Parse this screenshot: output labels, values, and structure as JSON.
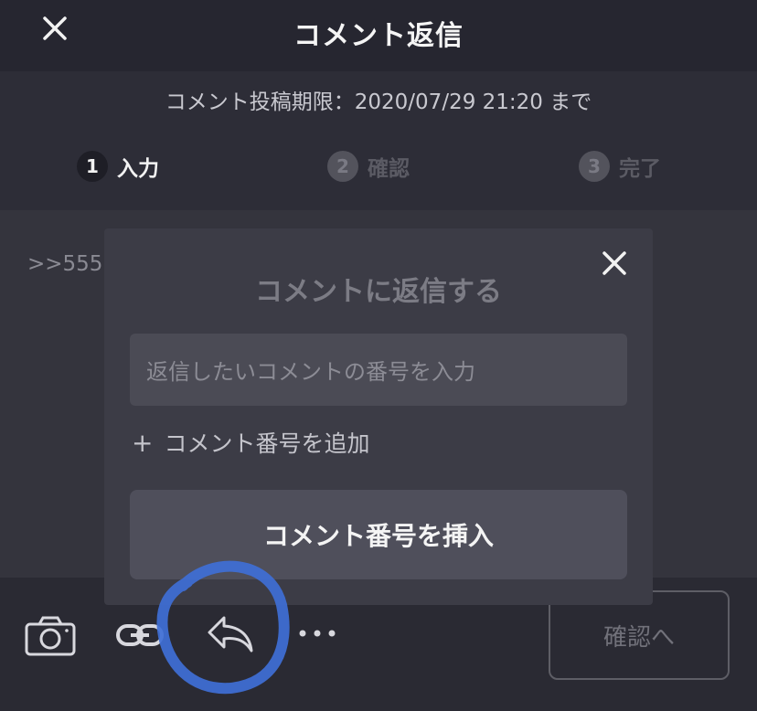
{
  "header": {
    "title": "コメント返信",
    "close_icon": "close-icon"
  },
  "deadline": "コメント投稿期限：2020/07/29 21:20 まで",
  "steps": [
    {
      "num": "1",
      "label": "入力",
      "state": "active"
    },
    {
      "num": "2",
      "label": "確認",
      "state": "inactive"
    },
    {
      "num": "3",
      "label": "完了",
      "state": "inactive"
    }
  ],
  "content": {
    "text": ">>555"
  },
  "modal": {
    "title": "コメントに返信する",
    "input_placeholder": "返信したいコメントの番号を入力",
    "add_label": "コメント番号を追加",
    "insert_label": "コメント番号を挿入"
  },
  "toolbar": {
    "icons": [
      "camera-icon",
      "link-icon",
      "reply-icon",
      "more-icon"
    ],
    "confirm_label": "確認へ"
  },
  "colors": {
    "background": "#27272f",
    "modal": "#3c3c46",
    "highlight": "#3f6fd6"
  }
}
